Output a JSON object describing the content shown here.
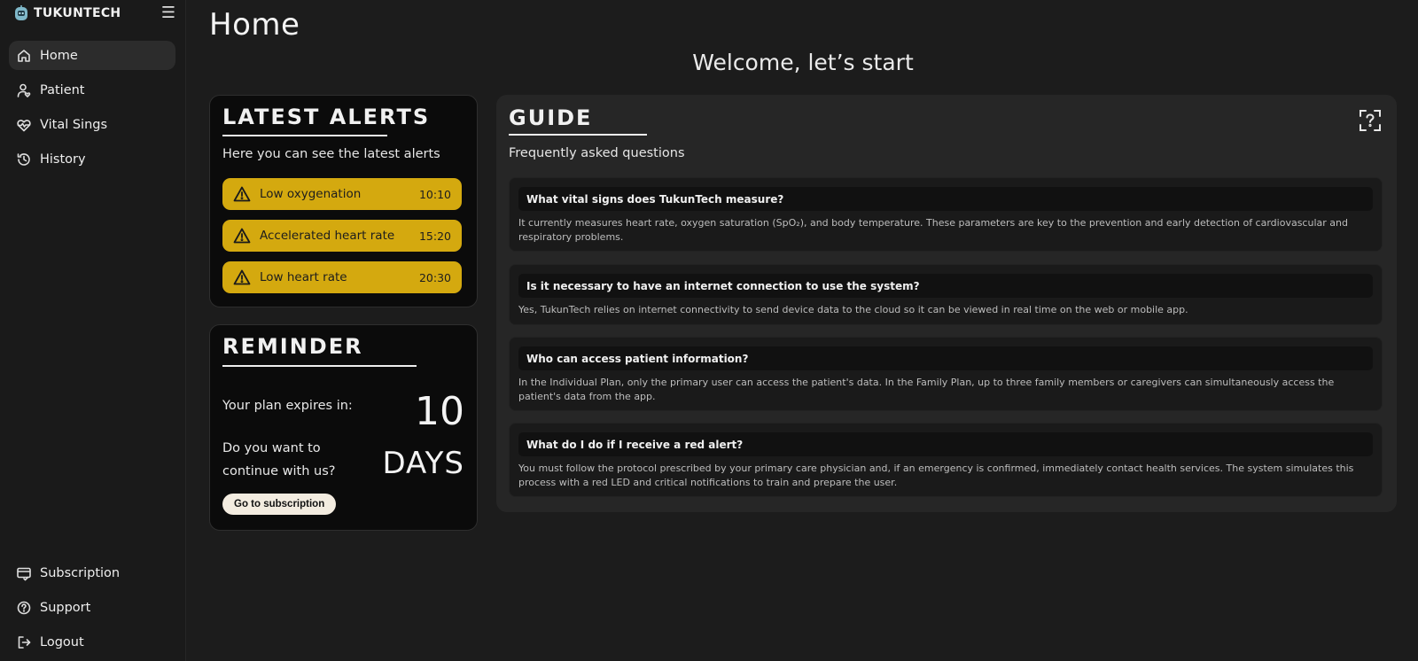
{
  "app": {
    "brand": "TUKUNTECH",
    "menu_icon": "hamburger-icon",
    "brand_icon": "robot-logo-icon"
  },
  "sidebar": {
    "items": [
      {
        "label": "Home",
        "icon": "home-icon",
        "active": true
      },
      {
        "label": "Patient",
        "icon": "user-heart-icon"
      },
      {
        "label": "Vital Sings",
        "icon": "heart-pulse-icon"
      },
      {
        "label": "History",
        "icon": "history-icon"
      }
    ],
    "bottom": [
      {
        "label": "Subscription",
        "icon": "card-check-icon"
      },
      {
        "label": "Support",
        "icon": "help-circle-icon"
      },
      {
        "label": "Logout",
        "icon": "logout-icon"
      }
    ]
  },
  "page": {
    "title": "Home",
    "welcome": "Welcome, let’s start"
  },
  "alerts": {
    "title": "LATEST ALERTS",
    "subtitle": "Here you can see the latest alerts",
    "items": [
      {
        "label": "Low oxygenation",
        "time": "10:10"
      },
      {
        "label": "Accelerated heart rate",
        "time": "15:20"
      },
      {
        "label": "Low heart rate",
        "time": "20:30"
      }
    ],
    "color": "#d4a90f"
  },
  "reminder": {
    "title": "REMINDER",
    "expires_text": "Your plan expires in:",
    "continue_line1": "Do you want to",
    "continue_line2": "continue with us?",
    "days_number": "10",
    "days_unit": "DAYS",
    "button": "Go to subscription"
  },
  "guide": {
    "title": "GUIDE",
    "subtitle": "Frequently asked questions",
    "help_icon": "scan-question-icon",
    "faqs": [
      {
        "question": "What vital signs does TukunTech measure?",
        "answer": "It currently measures heart rate, oxygen saturation (SpO₂), and body temperature. These parameters are key to the prevention and early detection of cardiovascular and respiratory problems."
      },
      {
        "question": "Is it necessary to have an internet connection to use the system?",
        "answer": "Yes, TukunTech relies on internet connectivity to send device data to the cloud so it can be viewed in real time on the web or mobile app."
      },
      {
        "question": "Who can access patient information?",
        "answer": "In the Individual Plan, only the primary user can access the patient's data. In the Family Plan, up to three family members or caregivers can simultaneously access the patient's data from the app."
      },
      {
        "question": "What do I do if I receive a red alert?",
        "answer": "You must follow the protocol prescribed by your primary care physician and, if an emergency is confirmed, immediately contact health services. The system simulates this process with a red LED and critical notifications to train and prepare the user."
      }
    ]
  }
}
